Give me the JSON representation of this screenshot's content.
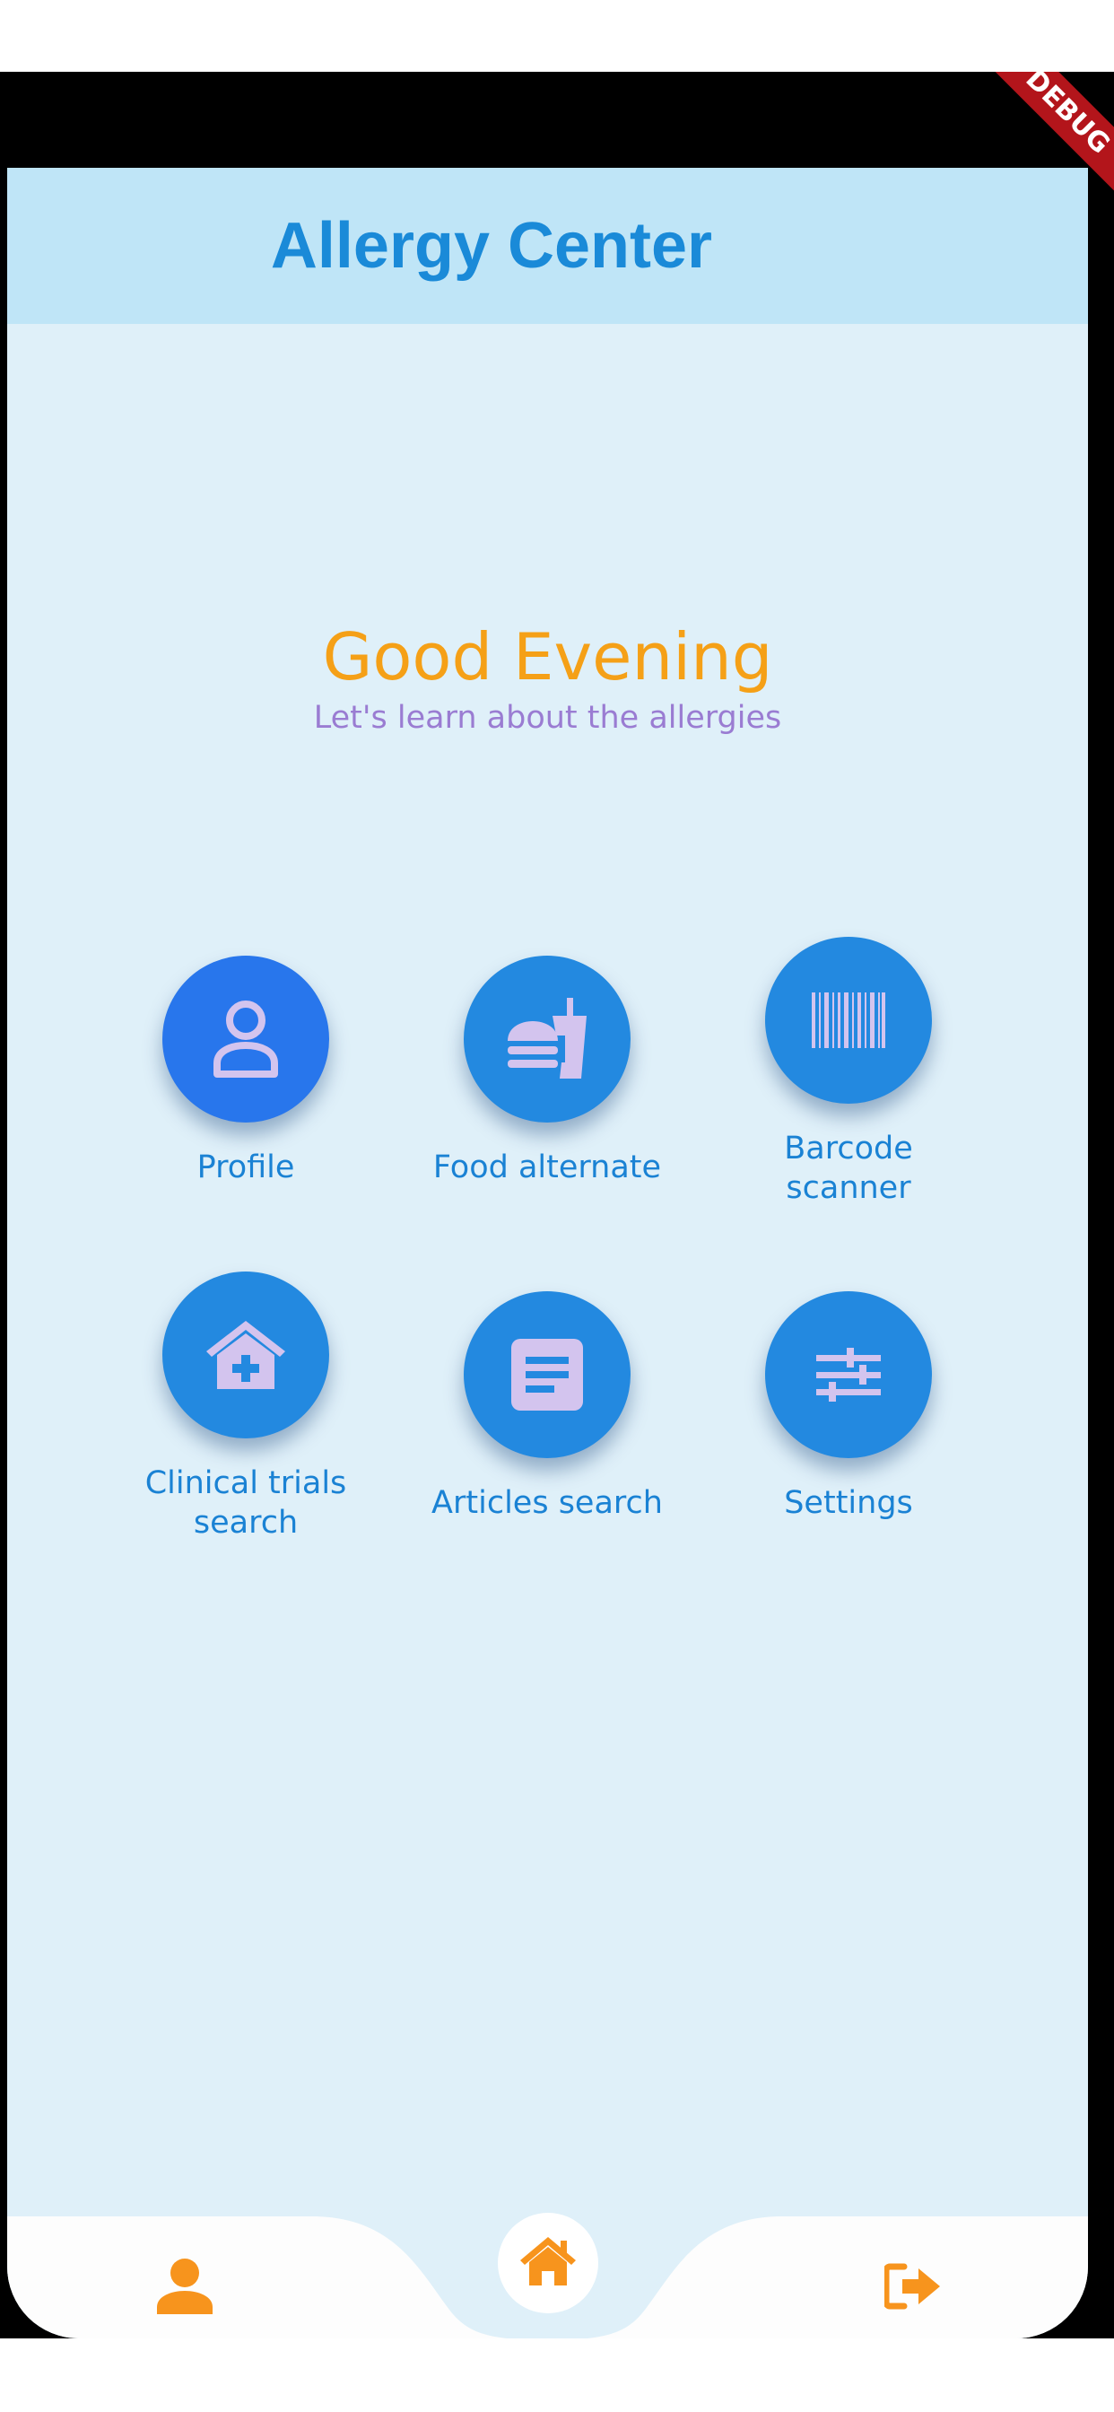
{
  "app_bar": {
    "title": "Allergy Center"
  },
  "debug_banner": {
    "label": "DEBUG"
  },
  "greeting": {
    "title": "Good Evening",
    "subtitle": "Let's learn about the allergies"
  },
  "tiles": [
    {
      "label": "Profile",
      "icon": "person-outline-icon"
    },
    {
      "label": "Food alternate",
      "icon": "fastfood-icon"
    },
    {
      "label": "Barcode scanner",
      "icon": "barcode-icon"
    },
    {
      "label": "Clinical trials search",
      "icon": "local-hospital-house-icon"
    },
    {
      "label": "Articles search",
      "icon": "article-icon"
    },
    {
      "label": "Settings",
      "icon": "tune-icon"
    }
  ],
  "bottom_nav": {
    "items": [
      {
        "name": "profile",
        "icon": "person-icon"
      },
      {
        "name": "home",
        "icon": "home-icon"
      },
      {
        "name": "logout",
        "icon": "logout-icon"
      }
    ]
  },
  "colors": {
    "app_bar_bg": "#bfe5f7",
    "screen_bg": "#dff0f9",
    "title": "#1a8ad8",
    "greeting": "#f5a017",
    "subtitle": "#9a7cd2",
    "tile_circle": "#2389e0",
    "tile_icon": "#d3c4ee",
    "nav_icon": "#f7941d"
  }
}
